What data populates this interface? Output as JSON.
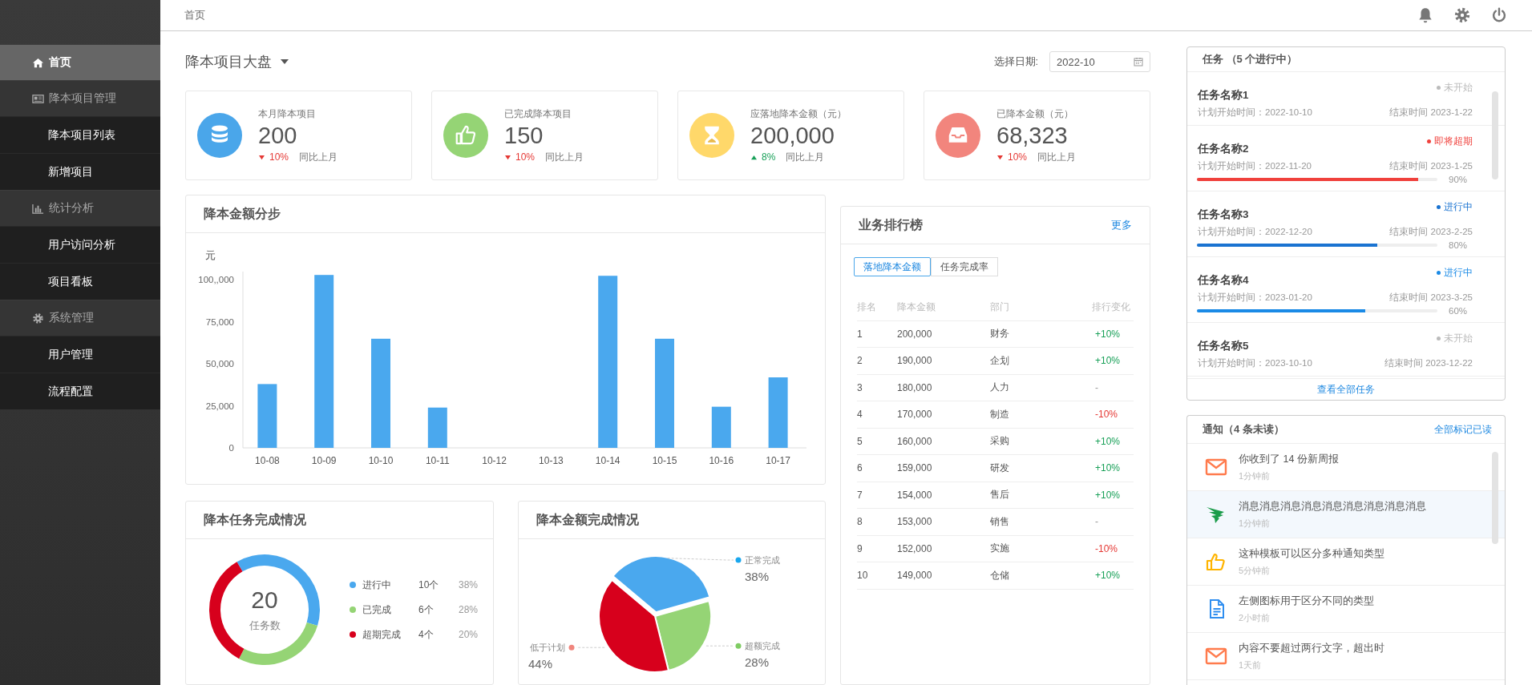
{
  "sidebar": {
    "items": [
      {
        "label": "首页",
        "selected": true
      },
      {
        "label": "降本项目管理",
        "selected": false,
        "children": [
          {
            "label": "降本项目列表",
            "selected": false
          },
          {
            "label": "新增项目",
            "selected": false
          }
        ]
      },
      {
        "label": "统计分析",
        "selected": false,
        "children": [
          {
            "label": "用户访问分析",
            "selected": false
          },
          {
            "label": "项目看板",
            "selected": false
          }
        ]
      },
      {
        "label": "系统管理",
        "selected": false,
        "children": [
          {
            "label": "用户管理",
            "selected": false
          },
          {
            "label": "流程配置",
            "selected": false
          }
        ]
      }
    ]
  },
  "topbar": {
    "breadcrumb": "首页"
  },
  "dashboard": {
    "title": "降本项目大盘",
    "date_label": "选择日期:",
    "date_value": "2022-10"
  },
  "stats": [
    {
      "label": "本月降本项目",
      "value": "200",
      "change": "10%",
      "rising": false,
      "compare": "同比上月",
      "color": "#4aa6ea"
    },
    {
      "label": "已完成降本项目",
      "value": "150",
      "change": "10%",
      "rising": false,
      "compare": "同比上月",
      "color": "#95d475"
    },
    {
      "label": "应落地降本金额（元）",
      "value": "200,000",
      "change": "8%",
      "rising": true,
      "compare": "同比上月",
      "color": "#ffd86a"
    },
    {
      "label": "已降本金额（元）",
      "value": "68,323",
      "change": "10%",
      "rising": false,
      "compare": "同比上月",
      "color": "#f2857d"
    }
  ],
  "bar_card": {
    "title": "降本金额分步",
    "chart_data": {
      "type": "bar",
      "ylabel": "元",
      "categories": [
        "10-08",
        "10-09",
        "10-10",
        "10-11",
        "10-12",
        "10-13",
        "10-14",
        "10-15",
        "10-16",
        "10-17"
      ],
      "series": [
        {
          "color": "#4aa8ee",
          "values": [
            38000,
            103000,
            65000,
            24000,
            0,
            0,
            102500,
            65000,
            24500,
            42000
          ]
        }
      ],
      "ylim": [
        0,
        105000
      ],
      "yticks": [
        {
          "value": 0,
          "label": "0"
        },
        {
          "value": 25000,
          "label": "25,000"
        },
        {
          "value": 50000,
          "label": "50,000"
        },
        {
          "value": 75000,
          "label": "75,000"
        },
        {
          "value": 100000,
          "label": "100,,000"
        }
      ]
    }
  },
  "task_card": {
    "title": "降本任务完成情况",
    "center_value": "20",
    "center_label": "任务数",
    "legend": [
      {
        "count": "10个",
        "percent": "38%"
      },
      {
        "count": "6个",
        "percent": "28%"
      },
      {
        "count": "4个",
        "percent": "20%"
      }
    ],
    "chart_data": {
      "type": "donut",
      "categories": [
        "进行中",
        "已完成",
        "超期完成"
      ],
      "values": [
        38,
        28,
        34
      ]
    }
  },
  "amount_card": {
    "title": "降本金额完成情况",
    "chart_data": {
      "type": "pie",
      "categories": [
        "正常完成",
        "超额完成",
        "低于计划"
      ],
      "values": [
        38,
        28,
        44
      ],
      "value_labels": [
        "38%",
        "28%",
        "44%"
      ]
    }
  },
  "ranking": {
    "title": "业务排行榜",
    "more": "更多",
    "tabs": [
      {
        "label": "落地降本金额",
        "selected": true
      },
      {
        "label": "任务完成率",
        "selected": false
      }
    ],
    "columns": [
      "排名",
      "降本金额",
      "部门",
      "排行变化"
    ],
    "rows": [
      {
        "rank": "1",
        "amount": "200,000",
        "dept": "财务",
        "change": "+10%",
        "color": "#18a058"
      },
      {
        "rank": "2",
        "amount": "190,000",
        "dept": "企划",
        "change": "+10%",
        "color": "#18a058"
      },
      {
        "rank": "3",
        "amount": "180,000",
        "dept": "人力",
        "change": "-"
      },
      {
        "rank": "4",
        "amount": "170,000",
        "dept": "制造",
        "change": "-10%",
        "color": "#e53935"
      },
      {
        "rank": "5",
        "amount": "160,000",
        "dept": "采购",
        "change": "+10%",
        "color": "#18a058"
      },
      {
        "rank": "6",
        "amount": "159,000",
        "dept": "研发",
        "change": "+10%",
        "color": "#18a058"
      },
      {
        "rank": "7",
        "amount": "154,000",
        "dept": "售后",
        "change": "+10%",
        "color": "#18a058"
      },
      {
        "rank": "8",
        "amount": "153,000",
        "dept": "销售",
        "change": "-"
      },
      {
        "rank": "9",
        "amount": "152,000",
        "dept": "实施",
        "change": "-10%",
        "color": "#e53935"
      },
      {
        "rank": "10",
        "amount": "149,000",
        "dept": "仓储",
        "change": "+10%",
        "color": "#18a058"
      }
    ]
  },
  "tasks": {
    "title": "任务 （5 个进行中）",
    "footer": "查看全部任务",
    "items": [
      {
        "name": "任务名称1",
        "status": "未开始",
        "color": "#bbbbbb",
        "start": "计划开始时间：2022-10-10",
        "end": "结束时间 2023-1-22"
      },
      {
        "name": "任务名称2",
        "status": "即将超期",
        "color": "#f0413c",
        "start": "计划开始时间：2022-11-20",
        "end": "结束时间 2023-1-25",
        "level": 0.92,
        "percent": "90%"
      },
      {
        "name": "任务名称3",
        "status": "进行中",
        "color": "#1a73d1",
        "start": "计划开始时间：2022-12-20",
        "end": "结束时间 2023-2-25",
        "level": 0.75,
        "percent": "80%"
      },
      {
        "name": "任务名称4",
        "status": "进行中",
        "color": "#1a8ae6",
        "start": "计划开始时间：2023-01-20",
        "end": "结束时间 2023-3-25",
        "level": 0.7,
        "percent": "60%"
      },
      {
        "name": "任务名称5",
        "status": "未开始",
        "color": "#bbbbbb",
        "start": "计划开始时间：2023-10-10",
        "end": "结束时间 2023-12-22"
      }
    ]
  },
  "notices": {
    "title": "通知（4 条未读）",
    "action": "全部标记已读",
    "items": [
      {
        "text": "你收到了 14 份新周报",
        "time": "1分钟前",
        "selected": false
      },
      {
        "text": "消息消息消息消息消息消息消息消息消息",
        "time": "1分钟前",
        "selected": true
      },
      {
        "text": "这种模板可以区分多种通知类型",
        "time": "5分钟前",
        "selected": false
      },
      {
        "text": "左侧图标用于区分不同的类型",
        "time": "2小时前",
        "selected": false
      },
      {
        "text": "内容不要超过两行文字，超出时",
        "time": "1天前",
        "selected": false
      }
    ]
  }
}
